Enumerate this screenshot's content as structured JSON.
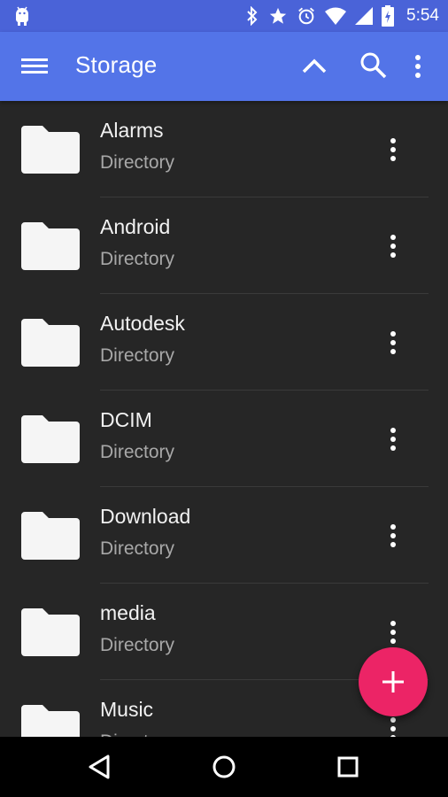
{
  "status_bar": {
    "time": "5:54",
    "icons": [
      "android-debug-icon",
      "bluetooth-icon",
      "star-icon",
      "alarm-icon",
      "wifi-icon",
      "signal-icon",
      "battery-charging-icon"
    ]
  },
  "app_bar": {
    "title": "Storage",
    "icons": [
      "menu-icon",
      "chevron-up-icon",
      "search-icon",
      "more-vert-icon"
    ]
  },
  "files": [
    {
      "name": "Alarms",
      "type": "Directory"
    },
    {
      "name": "Android",
      "type": "Directory"
    },
    {
      "name": "Autodesk",
      "type": "Directory"
    },
    {
      "name": "DCIM",
      "type": "Directory"
    },
    {
      "name": "Download",
      "type": "Directory"
    },
    {
      "name": "media",
      "type": "Directory"
    },
    {
      "name": "Music",
      "type": "Directory"
    }
  ],
  "fab": {
    "icon": "plus-icon",
    "color": "#ec2466"
  },
  "nav_bar": {
    "icons": [
      "back-icon",
      "home-icon",
      "recents-icon"
    ]
  },
  "colors": {
    "status_bar": "#4a63d8",
    "app_bar": "#5374e8",
    "background": "#262626",
    "accent": "#ec2466"
  }
}
